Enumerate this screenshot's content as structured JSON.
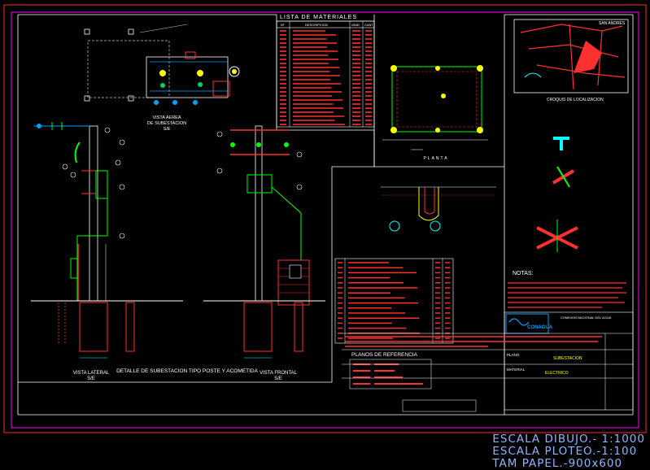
{
  "drawing": {
    "materials_title": "LISTA DE MATERIALES",
    "materials_headers": [
      "Nº",
      "DESCRIPCION",
      "UNID",
      "CANT"
    ],
    "material_rows": 24,
    "vista_aerea": [
      "VISTA AEREA",
      "DE SUBESTACION",
      "S/E"
    ],
    "vista_lateral": [
      "VISTA LATERAL",
      "S/E"
    ],
    "vista_frontal": [
      "VISTA FRONTAL",
      "S/E"
    ],
    "main_caption": "DETALLE DE SUBESTACION TIPO POSTE Y ACOMETIDA",
    "planta_label": "PLANTA",
    "croquis_title": "CROQUIS DE LOCALIZACION",
    "san_andres": "SAN ANDRES",
    "notas_title": "NOTAS:",
    "planos_title": "PLANOS DE REFERENCIA",
    "title_block": {
      "org": "COMISION NACIONAL DEL AGUA",
      "logo": "CONAGUA",
      "subestacion": "SUBESTACION",
      "electrico": "ELECTRICO",
      "plano_label": "PLANO",
      "material_label": "MATERIAL"
    }
  },
  "footer": {
    "escala_dibujo": "ESCALA DIBUJO.- 1:1000",
    "escala_ploteo": "ESCALA PLOTEO.-1:100",
    "tam_papel": "TAM PAPEL.-900x600"
  }
}
